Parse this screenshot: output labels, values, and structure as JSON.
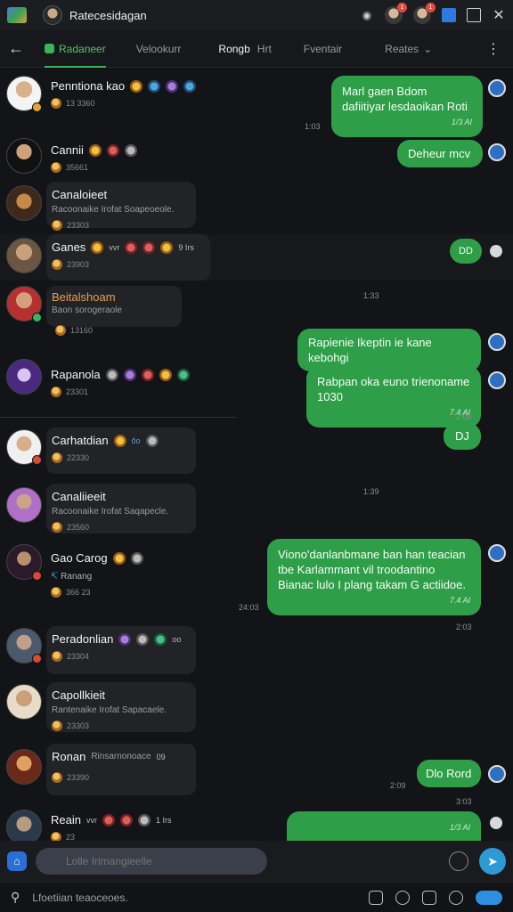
{
  "titlebar": {
    "title": "Ratecesidagan",
    "badge_1": "1",
    "badge_2": "1"
  },
  "tabs": [
    {
      "label": "Radaneer"
    },
    {
      "label": "Velookurr"
    },
    {
      "label": "Rongb"
    },
    {
      "label": "Hrt"
    },
    {
      "label": "Fventair"
    },
    {
      "label": "Reates"
    }
  ],
  "messages_in": [
    {
      "name": "Penntiona kao",
      "meta": "13 3360"
    },
    {
      "name": "Cannii",
      "meta": "35661"
    },
    {
      "name": "Canaloieet",
      "sub": "Racoonaike Irofat Soapeoeole.",
      "meta": "23303"
    },
    {
      "name": "Ganes",
      "extra": "vvr",
      "extra2": "9 Irs",
      "meta": "23903"
    },
    {
      "name": "Beitalshoam",
      "sub": "Baon sorogeraole",
      "meta": "13160"
    },
    {
      "name": "Rapanola",
      "meta": "23301"
    },
    {
      "name": "Carhatdian",
      "extra": "ǒo",
      "meta": "22330"
    },
    {
      "name": "Canaliieeit",
      "sub": "Racoonaike Irofat Saqapecle.",
      "meta": "23560"
    },
    {
      "name": "Gao Carog",
      "sub": "Ranang",
      "meta": "366 23"
    },
    {
      "name": "Peradonlian",
      "extra": "oo",
      "meta": "23304"
    },
    {
      "name": "Capollkieit",
      "sub": "Rantenaike Irofat Sapacaele.",
      "meta": "23303"
    },
    {
      "name": "Ronan",
      "sub": "Rinsarnonoace",
      "extra": "09",
      "meta": "23390"
    },
    {
      "name": "Reain",
      "extra": "vvr",
      "extra2": "1 Irs",
      "meta": "23"
    }
  ],
  "messages_out": [
    {
      "text": "Marl gaen Bdom dafiitiyar lesdaoikan Roti",
      "time": "1/3 AI"
    },
    {
      "text": "Deheur mcv"
    },
    {
      "text": "DD"
    },
    {
      "text": "Rapienie Ikeptin ie kane kebohgi"
    },
    {
      "text": "Rabpan oka euno trienoname 1030",
      "time": "7.4 AI"
    },
    {
      "text": "DJ"
    },
    {
      "text": "Viono'danlanbmane ban han teacian tbe Karlammant vil troodantino Bianac lulo I plang takam G actiidoe.",
      "time": "7.4 AI"
    },
    {
      "text": "Dlo Rord"
    },
    {
      "text": "",
      "time": "1/3 AI"
    }
  ],
  "stamps": [
    "1:03",
    "1:33",
    "2:09",
    "1:39",
    "24:03",
    "2:03",
    "2:09",
    "3:03"
  ],
  "composer": {
    "placeholder": "Lolle Irimangieelle"
  },
  "bottombar": {
    "text": "Lfoetiian teaoceoes."
  },
  "colors": {
    "accent": "#2f9e48",
    "bubble_in": "#222327",
    "background": "#131417"
  }
}
